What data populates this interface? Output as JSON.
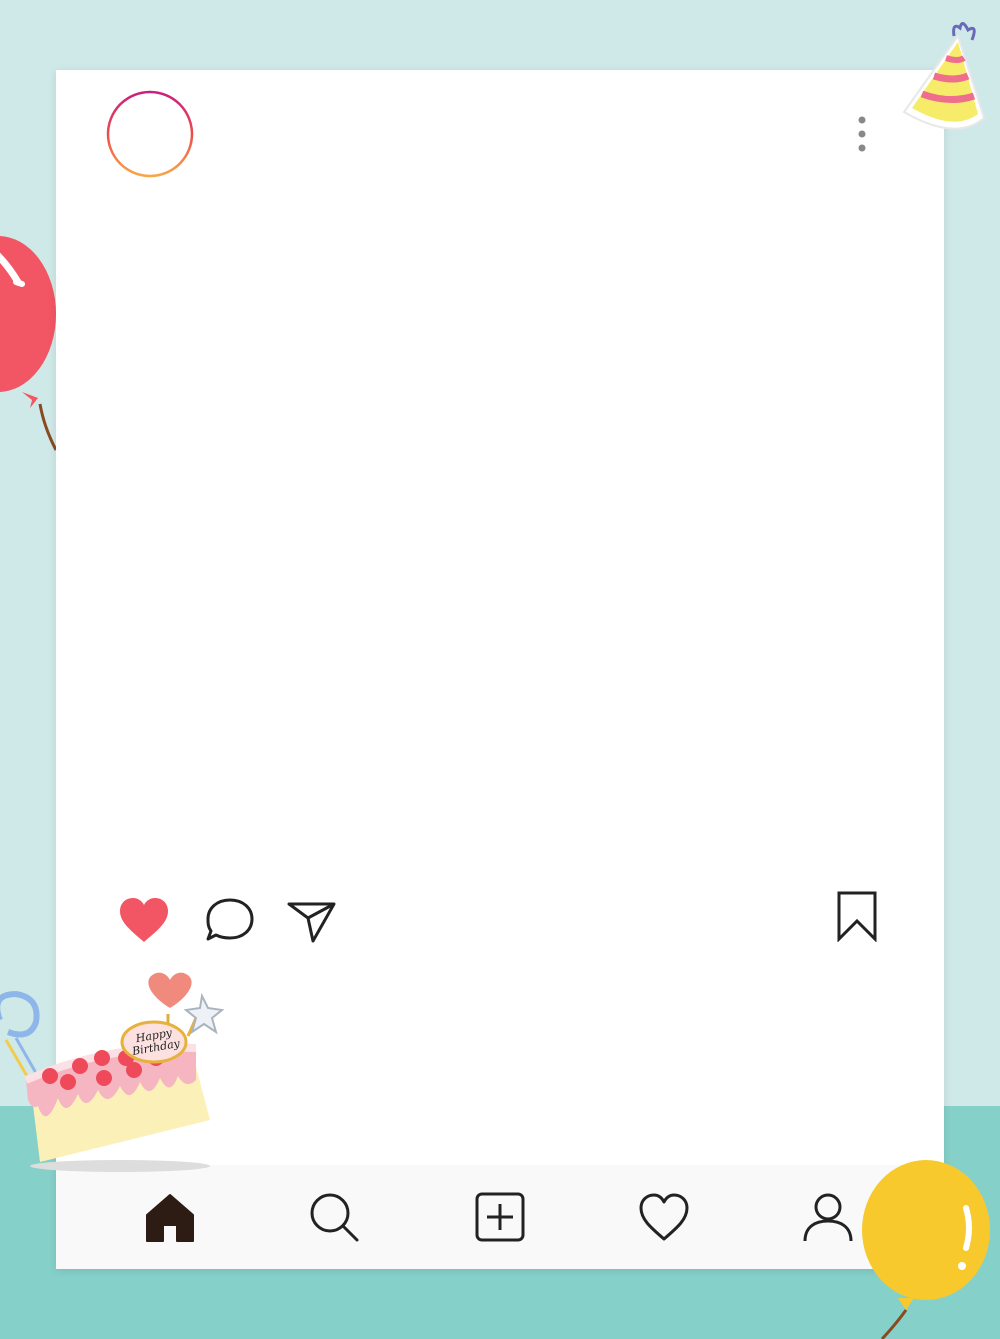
{
  "colors": {
    "background_top": "#cfe8e8",
    "background_bottom": "#86d0ca",
    "card": "#ffffff",
    "like_heart": "#f25563",
    "icon_stroke": "#222222",
    "home_fill": "#2d1c14",
    "nav_bar": "#f9f9f9"
  },
  "post": {
    "header": {
      "avatar_icon": "story-ring-avatar",
      "menu_icon": "more-vertical-icon"
    },
    "actions": {
      "like_icon": "heart-filled-icon",
      "comment_icon": "comment-bubble-icon",
      "share_icon": "paper-plane-icon",
      "bookmark_icon": "bookmark-icon"
    }
  },
  "bottom_nav": {
    "items": [
      {
        "icon": "home-icon"
      },
      {
        "icon": "search-icon"
      },
      {
        "icon": "add-post-icon"
      },
      {
        "icon": "heart-outline-icon"
      },
      {
        "icon": "profile-icon"
      }
    ]
  },
  "decorations": {
    "cake_topper_text": "Happy Birthday"
  }
}
